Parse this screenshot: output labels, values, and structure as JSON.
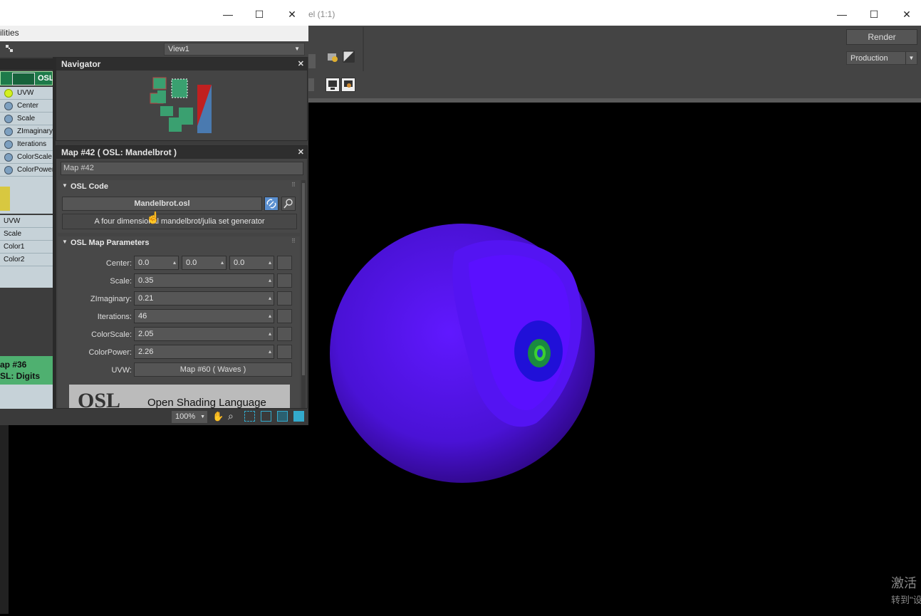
{
  "render_frame": {
    "title_fragment": "el (1:1)",
    "render_label": "Render",
    "preset": "Production",
    "win_controls": [
      "—",
      "☐",
      "✕"
    ]
  },
  "slate": {
    "menu_fragment": "ilities",
    "view_select": "View1",
    "win_controls": [
      "—",
      "☐",
      "✕"
    ],
    "nodes": {
      "osl_node_header": "OSL",
      "inputs": [
        "UVW",
        "Center",
        "Scale",
        "ZImaginary",
        "Iterations",
        "ColorScale",
        "ColorPower"
      ],
      "waves_rows": [
        "UVW",
        "Scale",
        "Color1",
        "Color2"
      ],
      "digits_node": [
        "ap #36",
        "SL: Digits"
      ]
    },
    "navigator": {
      "title": "Navigator"
    },
    "param_editor": {
      "title": "Map #42  ( OSL: Mandelbrot )",
      "map_name": "Map #42",
      "osl_code_section": "OSL Code",
      "osl_file": "Mandelbrot.osl",
      "description": "A four dimensional mandelbrot/julia set generator",
      "params_section": "OSL Map Parameters",
      "center_label": "Center:",
      "center": [
        "0.0",
        "0.0",
        "0.0"
      ],
      "scale_label": "Scale:",
      "scale": "0.35",
      "zimag_label": "ZImaginary:",
      "zimag": "0.21",
      "iterations_label": "Iterations:",
      "iterations": "46",
      "colorscale_label": "ColorScale:",
      "colorscale": "2.05",
      "colorpower_label": "ColorPower:",
      "colorpower": "2.26",
      "uvw_label": "UVW:",
      "uvw_map": "Map #60  ( Waves )",
      "banner_text": "Open Shading Language",
      "banner_logo": "OSL"
    },
    "zoom": "100%"
  },
  "watermark": {
    "line1": "激活",
    "line2": "转到\"设"
  },
  "colors": {
    "sphere": "#4a14d8",
    "accent_select": "#5a8fd0"
  }
}
